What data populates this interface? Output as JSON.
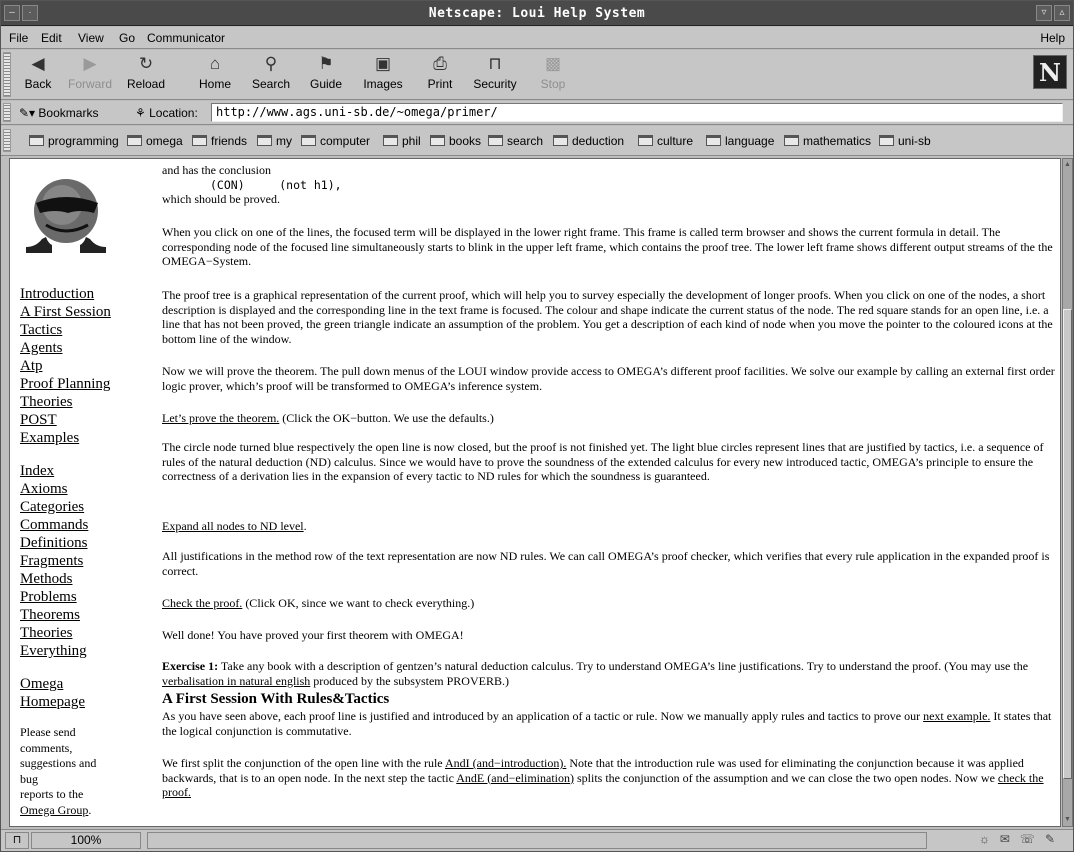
{
  "window": {
    "title": "Netscape: Loui Help System"
  },
  "menu": {
    "items": [
      "File",
      "Edit",
      "View",
      "Go",
      "Communicator"
    ],
    "help": "Help"
  },
  "toolbar": {
    "back": "Back",
    "forward": "Forward",
    "reload": "Reload",
    "home": "Home",
    "search": "Search",
    "guide": "Guide",
    "images": "Images",
    "print": "Print",
    "security": "Security",
    "stop": "Stop",
    "logo": "N"
  },
  "location": {
    "bookmarks_label": "Bookmarks",
    "label": "Location:",
    "url": "http://www.ags.uni-sb.de/~omega/primer/"
  },
  "personal_toolbar": {
    "items": [
      "programming",
      "omega",
      "friends",
      "my",
      "computer",
      "phil",
      "books",
      "search",
      "deduction",
      "culture",
      "language",
      "mathematics",
      "uni-sb"
    ]
  },
  "sidebar": {
    "links": [
      "Introduction",
      "A First Session",
      "Tactics",
      "Agents",
      "Atp",
      "Proof Planning",
      "Theories",
      "POST",
      "Examples"
    ],
    "index_links": [
      "Index",
      "Axioms",
      "Categories",
      "Commands",
      "Definitions",
      "Fragments",
      "Methods",
      "Problems",
      "Theorems",
      "Theories",
      "Everything"
    ],
    "homepage_line1": "Omega",
    "homepage_line2": "Homepage",
    "note_lines": [
      "Please send",
      "comments,",
      "suggestions and",
      "bug",
      "reports to the"
    ],
    "note_link": "Omega Group",
    "note_end": "."
  },
  "content": {
    "p0_line1": "and has the conclusion",
    "p0_con": "(CON)     (not h1),",
    "p0_line3": "which should be proved.",
    "p1": "When you click on one of the lines, the focused term will be displayed in the lower right frame. This frame is called term browser and shows the current formula in detail. The corresponding node of the focused line simultaneously starts to blink in the upper left frame, which contains the proof tree. The lower left frame shows different output streams of the the OMEGA−System.",
    "p2": "The proof tree is a graphical representation of the current proof, which will help you to survey especially the development of longer proofs. When you click on one of the nodes, a short description is displayed and the corresponding line in the text frame is focused. The colour and shape indicate the current status of the node. The red square stands for an open line, i.e. a line that has not been proved, the green triangle indicate an assumption of the problem. You get a description of each kind of node when you move the pointer to the coloured icons at the bottom line of the window.",
    "p3": "Now we will prove the theorem. The pull down menus of the LOUI window provide access to OMEGA’s different proof facilities. We solve our example by calling an external first order logic prover, which’s proof will be transformed to OMEGA’s inference system.",
    "p4_link": "Let’s prove the theorem.",
    "p4_rest": " (Click the OK−button. We use the defaults.)",
    "p5": "The circle node turned blue respectively the open line is now closed, but the proof is not finished yet. The light blue circles represent lines that are justified by tactics, i.e. a sequence of rules of the natural deduction (ND) calculus. Since we would have to prove the soundness of the extended calculus for every new introduced tactic, OMEGA’s principle to ensure the correctness of a derivation lies in the expansion of every tactic to ND rules for which the soundness is guaranteed.",
    "p6_link": "Expand all nodes to ND level",
    "p6_rest": ".",
    "p7": "All justifications in the method row of the text representation are now ND rules. We can call OMEGA’s proof checker, which verifies that every rule application in the expanded proof is correct.",
    "p8_link": "Check the proof.",
    "p8_rest": "  (Click OK,  since we want to check everything.)",
    "p9": "Well done! You have proved your first theorem with OMEGA!",
    "p10_bold": "Exercise 1:",
    "p10_a": " Take any book with a description of gentzen’s natural deduction calculus. Try to understand OMEGA’s line justifications. Try to understand the proof. (You may use the ",
    "p10_link": "verbalisation in natural english",
    "p10_b": " produced by the subsystem PROVERB.)",
    "h_section": "A First Session With Rules&Tactics",
    "p11_a": "As you have seen above, each proof line is justified and introduced by an application of a tactic or rule. Now we manually apply rules and tactics to prove our ",
    "p11_link": "next example.",
    "p11_b": " It states that the logical conjunction is commutative.",
    "p12_a": "We first split the conjunction of the open line with the rule ",
    "p12_link1": "AndI (and−introduction).",
    "p12_b": " Note that the introduction rule was used for eliminating the conjunction because it was applied backwards, that is to an open node. In the next step the tactic ",
    "p12_link2": "AndE (and−elimination)",
    "p12_c": " splits the conjunction of the assumption and we can close the two open nodes. Now we ",
    "p12_link3": "check the proof."
  },
  "status": {
    "zoom": "100%"
  }
}
